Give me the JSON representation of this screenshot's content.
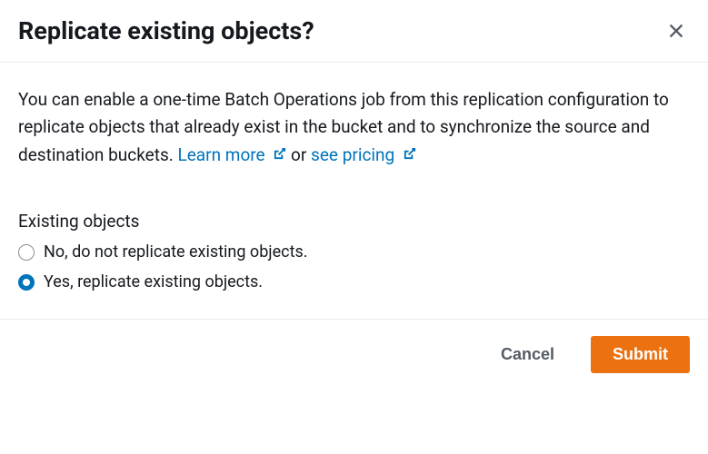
{
  "header": {
    "title": "Replicate existing objects?"
  },
  "body": {
    "description_part1": "You can enable a one-time Batch Operations job from this replication configuration to replicate objects that already exist in the bucket and to synchronize the source and destination buckets. ",
    "learn_more_label": "Learn more",
    "description_part2": " or ",
    "pricing_label": "see pricing",
    "section_label": "Existing objects",
    "radio_options": [
      {
        "label": "No, do not replicate existing objects.",
        "selected": false
      },
      {
        "label": "Yes, replicate existing objects.",
        "selected": true
      }
    ]
  },
  "footer": {
    "cancel_label": "Cancel",
    "submit_label": "Submit"
  }
}
